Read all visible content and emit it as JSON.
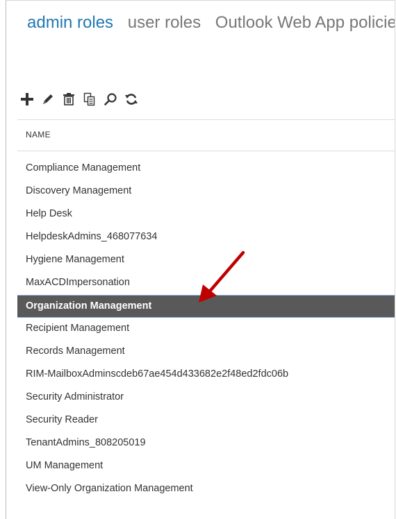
{
  "tabs": [
    {
      "label": "admin roles",
      "active": true
    },
    {
      "label": "user roles",
      "active": false
    },
    {
      "label": "Outlook Web App policies",
      "active": false
    }
  ],
  "toolbar": {
    "icons": [
      "add-icon",
      "edit-icon",
      "delete-icon",
      "copy-icon",
      "search-icon",
      "refresh-icon"
    ]
  },
  "table": {
    "column_header": "NAME",
    "selected_index": 6,
    "rows": [
      "Compliance Management",
      "Discovery Management",
      "Help Desk",
      "HelpdeskAdmins_468077634",
      "Hygiene Management",
      "MaxACDImpersonation",
      "Organization Management",
      "Recipient Management",
      "Records Management",
      "RIM-MailboxAdminscdeb67ae454d433682e2f48ed2fdc06b",
      "Security Administrator",
      "Security Reader",
      "TenantAdmins_808205019",
      "UM Management",
      "View-Only Organization Management"
    ]
  },
  "colors": {
    "accent": "#1f77b4",
    "selected_row": "#595959",
    "annotation_arrow": "#c00000"
  }
}
